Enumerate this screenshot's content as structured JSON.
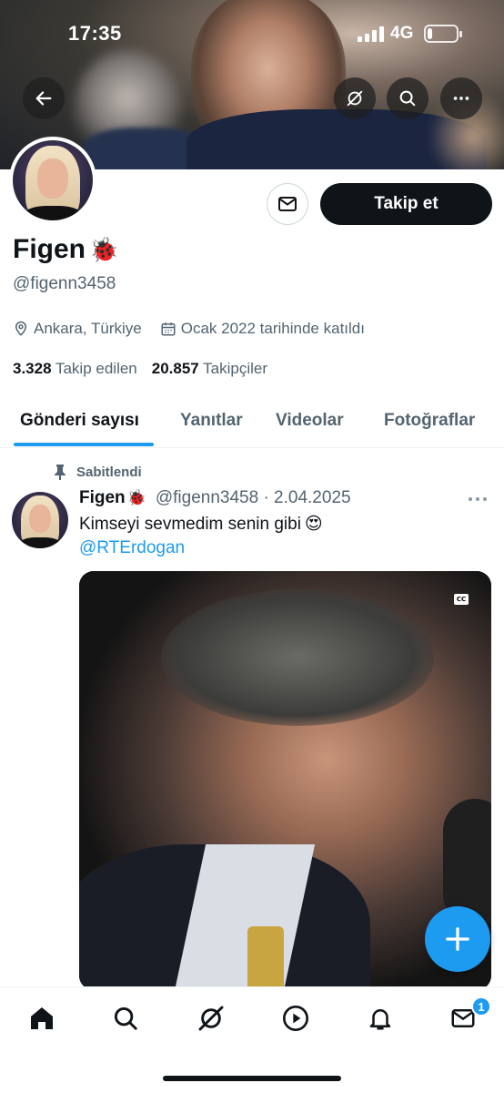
{
  "status_bar": {
    "time": "17:35",
    "network": "4G",
    "battery_level": 0.15
  },
  "banner": {
    "buttons": [
      "back-arrow-icon",
      "grok-icon",
      "search-icon",
      "more-icon"
    ]
  },
  "profile": {
    "follow_label": "Takip et",
    "display_name": "Figen",
    "name_emoji": "🐞",
    "handle": "@figenn3458",
    "location": "Ankara, Türkiye",
    "joined": "Ocak 2022 tarihinde katıldı",
    "following_count": "3.328",
    "following_label": "Takip edilen",
    "followers_count": "20.857",
    "followers_label": "Takipçiler"
  },
  "tabs": [
    {
      "label": "Gönderi sayısı",
      "active": true
    },
    {
      "label": "Yanıtlar",
      "active": false
    },
    {
      "label": "Videolar",
      "active": false
    },
    {
      "label": "Fotoğraflar",
      "active": false
    }
  ],
  "post": {
    "pinned_label": "Sabitlendi",
    "author": "Figen",
    "author_emoji": "🐞",
    "meta": "@figenn3458 · 2.04.2025",
    "text": "Kimseyi sevmedim senin gibi",
    "text_emoji": "😍",
    "mention": "@RTErdogan",
    "media_caption_badge": "CC"
  },
  "bottom_nav": {
    "items": [
      "home-icon",
      "search-icon",
      "grok-icon",
      "video-icon",
      "notifications-icon",
      "messages-icon"
    ],
    "messages_badge": "1"
  },
  "colors": {
    "accent": "#1d9bf0",
    "text_primary": "#0f1419",
    "text_secondary": "#536471",
    "button_dark": "#0f1419"
  }
}
